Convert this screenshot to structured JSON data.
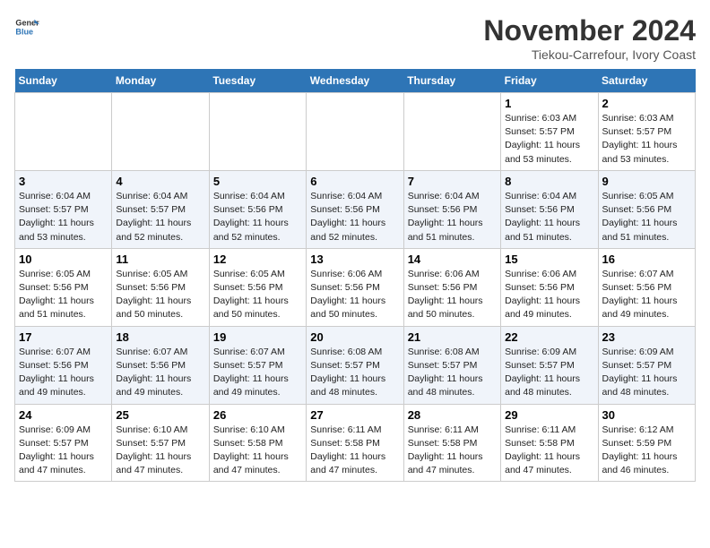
{
  "header": {
    "logo_line1": "General",
    "logo_line2": "Blue",
    "title": "November 2024",
    "subtitle": "Tiekou-Carrefour, Ivory Coast"
  },
  "weekdays": [
    "Sunday",
    "Monday",
    "Tuesday",
    "Wednesday",
    "Thursday",
    "Friday",
    "Saturday"
  ],
  "weeks": [
    [
      {
        "day": "",
        "info": ""
      },
      {
        "day": "",
        "info": ""
      },
      {
        "day": "",
        "info": ""
      },
      {
        "day": "",
        "info": ""
      },
      {
        "day": "",
        "info": ""
      },
      {
        "day": "1",
        "info": "Sunrise: 6:03 AM\nSunset: 5:57 PM\nDaylight: 11 hours and 53 minutes."
      },
      {
        "day": "2",
        "info": "Sunrise: 6:03 AM\nSunset: 5:57 PM\nDaylight: 11 hours and 53 minutes."
      }
    ],
    [
      {
        "day": "3",
        "info": "Sunrise: 6:04 AM\nSunset: 5:57 PM\nDaylight: 11 hours and 53 minutes."
      },
      {
        "day": "4",
        "info": "Sunrise: 6:04 AM\nSunset: 5:57 PM\nDaylight: 11 hours and 52 minutes."
      },
      {
        "day": "5",
        "info": "Sunrise: 6:04 AM\nSunset: 5:56 PM\nDaylight: 11 hours and 52 minutes."
      },
      {
        "day": "6",
        "info": "Sunrise: 6:04 AM\nSunset: 5:56 PM\nDaylight: 11 hours and 52 minutes."
      },
      {
        "day": "7",
        "info": "Sunrise: 6:04 AM\nSunset: 5:56 PM\nDaylight: 11 hours and 51 minutes."
      },
      {
        "day": "8",
        "info": "Sunrise: 6:04 AM\nSunset: 5:56 PM\nDaylight: 11 hours and 51 minutes."
      },
      {
        "day": "9",
        "info": "Sunrise: 6:05 AM\nSunset: 5:56 PM\nDaylight: 11 hours and 51 minutes."
      }
    ],
    [
      {
        "day": "10",
        "info": "Sunrise: 6:05 AM\nSunset: 5:56 PM\nDaylight: 11 hours and 51 minutes."
      },
      {
        "day": "11",
        "info": "Sunrise: 6:05 AM\nSunset: 5:56 PM\nDaylight: 11 hours and 50 minutes."
      },
      {
        "day": "12",
        "info": "Sunrise: 6:05 AM\nSunset: 5:56 PM\nDaylight: 11 hours and 50 minutes."
      },
      {
        "day": "13",
        "info": "Sunrise: 6:06 AM\nSunset: 5:56 PM\nDaylight: 11 hours and 50 minutes."
      },
      {
        "day": "14",
        "info": "Sunrise: 6:06 AM\nSunset: 5:56 PM\nDaylight: 11 hours and 50 minutes."
      },
      {
        "day": "15",
        "info": "Sunrise: 6:06 AM\nSunset: 5:56 PM\nDaylight: 11 hours and 49 minutes."
      },
      {
        "day": "16",
        "info": "Sunrise: 6:07 AM\nSunset: 5:56 PM\nDaylight: 11 hours and 49 minutes."
      }
    ],
    [
      {
        "day": "17",
        "info": "Sunrise: 6:07 AM\nSunset: 5:56 PM\nDaylight: 11 hours and 49 minutes."
      },
      {
        "day": "18",
        "info": "Sunrise: 6:07 AM\nSunset: 5:56 PM\nDaylight: 11 hours and 49 minutes."
      },
      {
        "day": "19",
        "info": "Sunrise: 6:07 AM\nSunset: 5:57 PM\nDaylight: 11 hours and 49 minutes."
      },
      {
        "day": "20",
        "info": "Sunrise: 6:08 AM\nSunset: 5:57 PM\nDaylight: 11 hours and 48 minutes."
      },
      {
        "day": "21",
        "info": "Sunrise: 6:08 AM\nSunset: 5:57 PM\nDaylight: 11 hours and 48 minutes."
      },
      {
        "day": "22",
        "info": "Sunrise: 6:09 AM\nSunset: 5:57 PM\nDaylight: 11 hours and 48 minutes."
      },
      {
        "day": "23",
        "info": "Sunrise: 6:09 AM\nSunset: 5:57 PM\nDaylight: 11 hours and 48 minutes."
      }
    ],
    [
      {
        "day": "24",
        "info": "Sunrise: 6:09 AM\nSunset: 5:57 PM\nDaylight: 11 hours and 47 minutes."
      },
      {
        "day": "25",
        "info": "Sunrise: 6:10 AM\nSunset: 5:57 PM\nDaylight: 11 hours and 47 minutes."
      },
      {
        "day": "26",
        "info": "Sunrise: 6:10 AM\nSunset: 5:58 PM\nDaylight: 11 hours and 47 minutes."
      },
      {
        "day": "27",
        "info": "Sunrise: 6:11 AM\nSunset: 5:58 PM\nDaylight: 11 hours and 47 minutes."
      },
      {
        "day": "28",
        "info": "Sunrise: 6:11 AM\nSunset: 5:58 PM\nDaylight: 11 hours and 47 minutes."
      },
      {
        "day": "29",
        "info": "Sunrise: 6:11 AM\nSunset: 5:58 PM\nDaylight: 11 hours and 47 minutes."
      },
      {
        "day": "30",
        "info": "Sunrise: 6:12 AM\nSunset: 5:59 PM\nDaylight: 11 hours and 46 minutes."
      }
    ]
  ]
}
